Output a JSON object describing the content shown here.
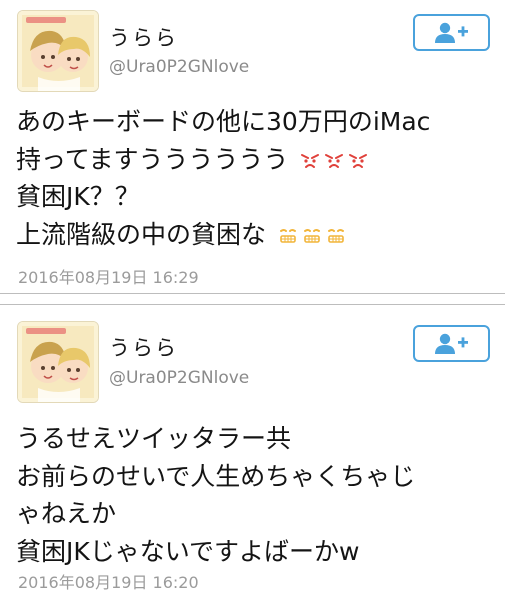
{
  "colors": {
    "accent": "#4aa2dc",
    "handle": "#8a8a8a",
    "timestamp": "#9b9b9b",
    "emoji_angry": "#e0403a",
    "emoji_grimace": "#f2b53a"
  },
  "tweets": [
    {
      "display_name": "うらら",
      "handle": "@Ura0P2GNlove",
      "follow_icon": "add-user-icon",
      "lines": [
        {
          "text": "あのキーボードの他に30万円のiMac",
          "emoji": []
        },
        {
          "text": "持ってますうううううう",
          "emoji": [
            "angry-face-icon",
            "angry-face-icon",
            "angry-face-icon"
          ]
        },
        {
          "text": "貧困JK？？",
          "emoji": []
        },
        {
          "text": "上流階級の中の貧困な",
          "emoji": [
            "grimacing-face-icon",
            "grimacing-face-icon",
            "grimacing-face-icon"
          ]
        }
      ],
      "timestamp": "2016年08月19日 16:29"
    },
    {
      "display_name": "うらら",
      "handle": "@Ura0P2GNlove",
      "follow_icon": "add-user-icon",
      "lines": [
        {
          "text": "うるせえツイッタラー共",
          "emoji": []
        },
        {
          "text": "お前らのせいで人生めちゃくちゃじ",
          "emoji": []
        },
        {
          "text": "ゃねえか",
          "emoji": []
        },
        {
          "text": "貧困JKじゃないですよばーかw",
          "emoji": []
        }
      ],
      "timestamp": "2016年08月19日 16:20"
    }
  ]
}
